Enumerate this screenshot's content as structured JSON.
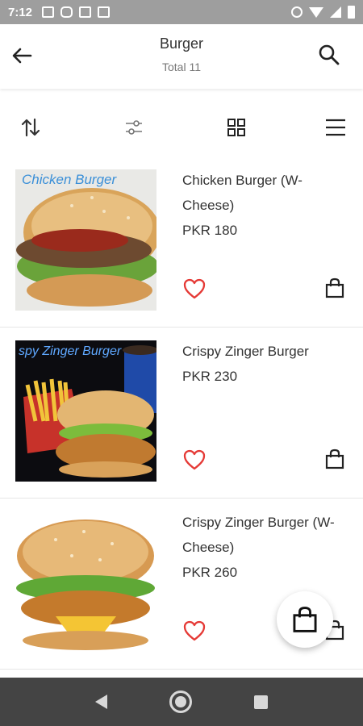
{
  "status_bar": {
    "time": "7:12",
    "left_icons": [
      "image-icon",
      "instagram-icon",
      "gmail-icon",
      "news-icon"
    ],
    "right_icons": [
      "alarm-icon",
      "wifi-icon",
      "signal-icon",
      "battery-icon"
    ]
  },
  "header": {
    "title": "Burger",
    "subtitle": "Total 11",
    "back_icon": "arrow-left-icon",
    "search_icon": "search-icon"
  },
  "toolbar": {
    "icons": [
      "sort-icon",
      "filter-icon",
      "grid-view-icon",
      "list-view-icon"
    ]
  },
  "products": [
    {
      "name": "Chicken Burger (W-Cheese)",
      "price": "PKR 180",
      "image_caption": "Chicken Burger"
    },
    {
      "name": "Crispy Zinger Burger",
      "price": "PKR 230",
      "image_caption": "spy Zinger Burger"
    },
    {
      "name": "Crispy Zinger Burger (W-Cheese)",
      "price": "PKR 260",
      "image_caption": ""
    }
  ],
  "colors": {
    "accent_heart": "#e53935",
    "status_bar": "#9e9e9e",
    "nav_bar": "#444444"
  },
  "fab": {
    "icon": "shopping-bag-icon"
  },
  "nav": {
    "icons": [
      "nav-back-icon",
      "nav-home-icon",
      "nav-recents-icon"
    ]
  }
}
